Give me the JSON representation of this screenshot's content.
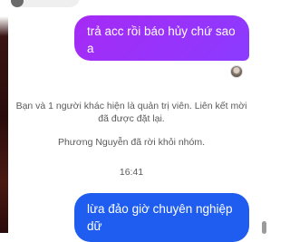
{
  "messages": [
    {
      "text": "trả acc rồi báo hủy chứ sao a",
      "color": "#9b33f8"
    },
    {
      "text": "lừa đảo giờ chuyên nghiệp dữ",
      "color": "#1e5df0"
    }
  ],
  "system": {
    "admin_notice": "Bạn và 1 người khác hiện là quản trị viên. Liên kết mời đã được đặt lại.",
    "left_group": "Phương Nguyễn đã rời khỏi nhóm.",
    "timestamp": "16:41"
  }
}
